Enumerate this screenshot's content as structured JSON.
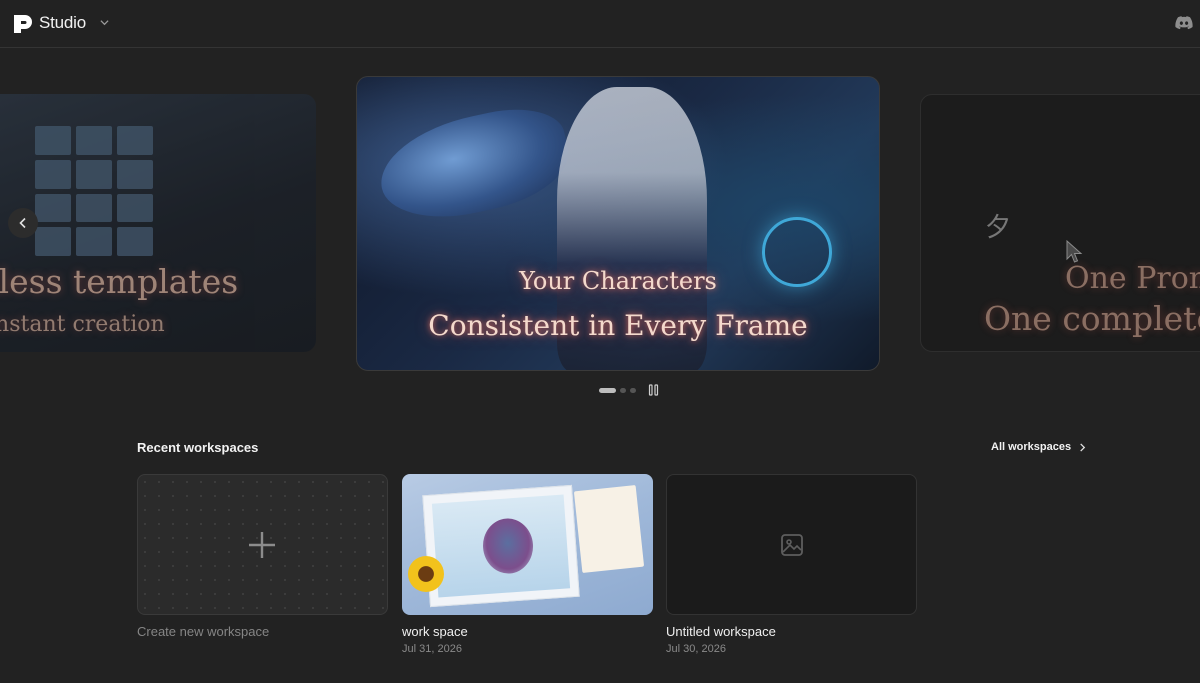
{
  "header": {
    "app_title": "Studio",
    "icons": [
      "logo-icon",
      "chevron-down-icon",
      "discord-icon"
    ]
  },
  "carousel": {
    "slides": [
      {
        "line1": "lless templates",
        "line2": "instant creation"
      },
      {
        "line1": "Your Characters",
        "line2": "Consistent in Every Frame"
      },
      {
        "glyph": "夕",
        "line1": "One Prom",
        "line2": "One complete"
      }
    ],
    "prev_icon": "chevron-left-icon",
    "dots": 3,
    "active_dot": 0,
    "pause_icon": "pause-icon"
  },
  "workspaces": {
    "title": "Recent workspaces",
    "all_link": "All workspaces",
    "cards": [
      {
        "label": "Create new workspace",
        "date": ""
      },
      {
        "label": "work space",
        "date": "Jul 31, 2026"
      },
      {
        "label": "Untitled workspace",
        "date": "Jul 30, 2026"
      }
    ]
  },
  "colors": {
    "background": "#222222",
    "card": "#2b2b2b",
    "accent_glow": "#f4d9cc"
  }
}
